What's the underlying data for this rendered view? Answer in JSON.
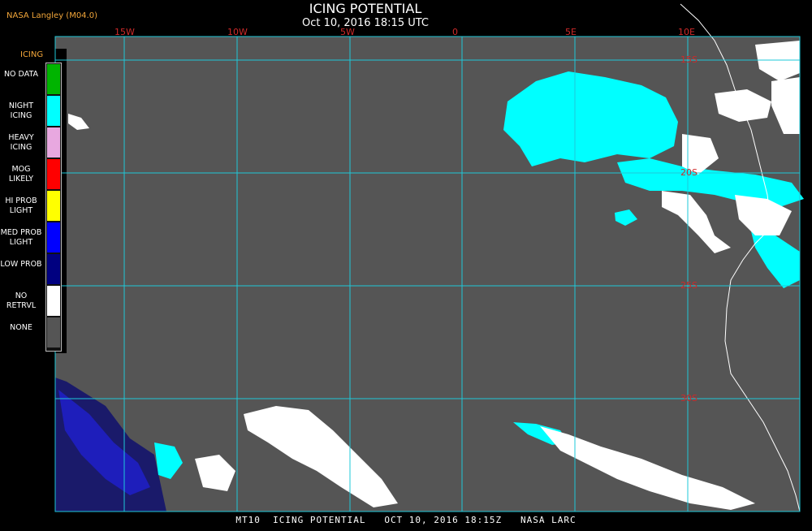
{
  "header": {
    "credit": "NASA Langley (M04.0)",
    "title": "ICING POTENTIAL",
    "subtitle": "Oct 10, 2016 18:15 UTC"
  },
  "legend": {
    "title": "ICING",
    "items": [
      {
        "label": "NO DATA",
        "color": "#00b400"
      },
      {
        "label": "NIGHT ICING",
        "color": "#00ffff"
      },
      {
        "label": "HEAVY ICING",
        "color": "#e8a8e0"
      },
      {
        "label": "MOG LIKELY",
        "color": "#ff0000"
      },
      {
        "label": "HI PROB LIGHT",
        "color": "#ffff00"
      },
      {
        "label": "MED PROB LIGHT",
        "color": "#0000ff"
      },
      {
        "label": "LOW PROB",
        "color": "#000080"
      },
      {
        "label": "NO RETRVL",
        "color": "#ffffff"
      },
      {
        "label": "NONE",
        "color": "#555555"
      }
    ]
  },
  "grid": {
    "lon_labels": [
      "15W",
      "10W",
      "5W",
      "0",
      "5E",
      "10E"
    ],
    "lat_labels": [
      "15S",
      "20S",
      "25S",
      "30S"
    ],
    "grid_color": "#1ec8d8",
    "label_color": "#cf2a2a",
    "map_bg": "#555555"
  },
  "footer": {
    "text": "MT10  ICING POTENTIAL   OCT 10, 2016 18:15Z   NASA LARC"
  }
}
